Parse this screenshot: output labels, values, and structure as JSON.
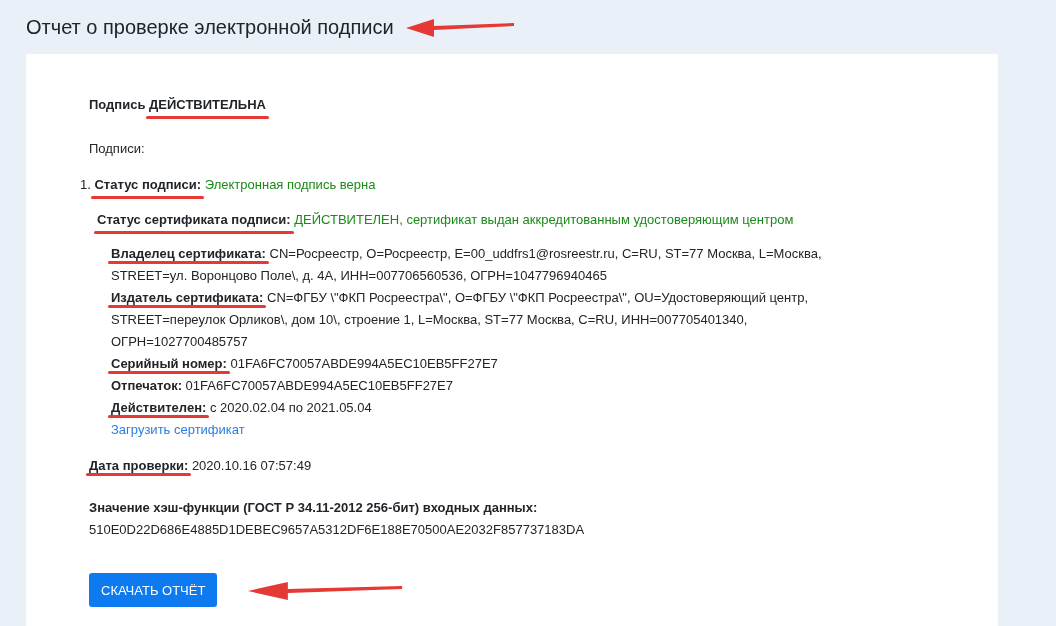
{
  "title": {
    "text": "Отчет о проверке электронной подписи",
    "arrow": true
  },
  "verdict": {
    "label": "Подпись",
    "value": "ДЕЙСТВИТЕЛЬНА",
    "underlined": true
  },
  "signatures_heading": "Подписи:",
  "signatures": [
    {
      "number": "1.",
      "status": {
        "label": "Статус подписи:",
        "value": "Электронная подпись верна",
        "positive": true,
        "underlined": true
      },
      "certificate_status": {
        "label": "Статус сертификата подписи:",
        "value": "ДЕЙСТВИТЕЛЕН, сертификат выдан аккредитованным удостоверяющим центром",
        "positive": true,
        "underlined": true
      },
      "details": [
        {
          "label": "Владелец сертификата:",
          "value": "CN=Росреестр, O=Росреестр, E=00_uddfrs1@rosreestr.ru, C=RU, ST=77 Москва, L=Москва, STREET=ул. Воронцово Поле\\, д. 4А, ИНН=007706560536, ОГРН=1047796940465",
          "underlined": true
        },
        {
          "label": "Издатель сертификата:",
          "value": "CN=ФГБУ \\\"ФКП Росреестра\\\", O=ФГБУ \\\"ФКП Росреестра\\\", OU=Удостоверяющий центр, STREET=переулок Орликов\\, дом 10\\, строение 1, L=Москва, ST=77 Москва, C=RU, ИНН=007705401340, ОГРН=1027700485757",
          "underlined": true
        },
        {
          "label": "Серийный номер:",
          "value": "01FA6FC70057ABDE994A5EC10EB5FF27E7",
          "underlined": true
        },
        {
          "label": "Отпечаток:",
          "value": "01FA6FC70057ABDE994A5EC10EB5FF27E7",
          "underlined": false
        },
        {
          "label": "Действителен:",
          "value": "с 2020.02.04 по 2021.05.04",
          "underlined": true
        }
      ],
      "download_link": "Загрузить сертификат"
    }
  ],
  "check_date": {
    "label": "Дата проверки:",
    "value": "2020.10.16 07:57:49",
    "underlined": true
  },
  "hash": {
    "label": "Значение хэш-функции (ГОСТ Р 34.11-2012 256-бит) входных данных:",
    "value": "510E0D22D686E4885D1DEBEC9657A5312DF6E188E70500AE2032F857737183DA"
  },
  "download_button": {
    "label": "СКАЧАТЬ ОТЧЁТ",
    "arrow": true
  }
}
